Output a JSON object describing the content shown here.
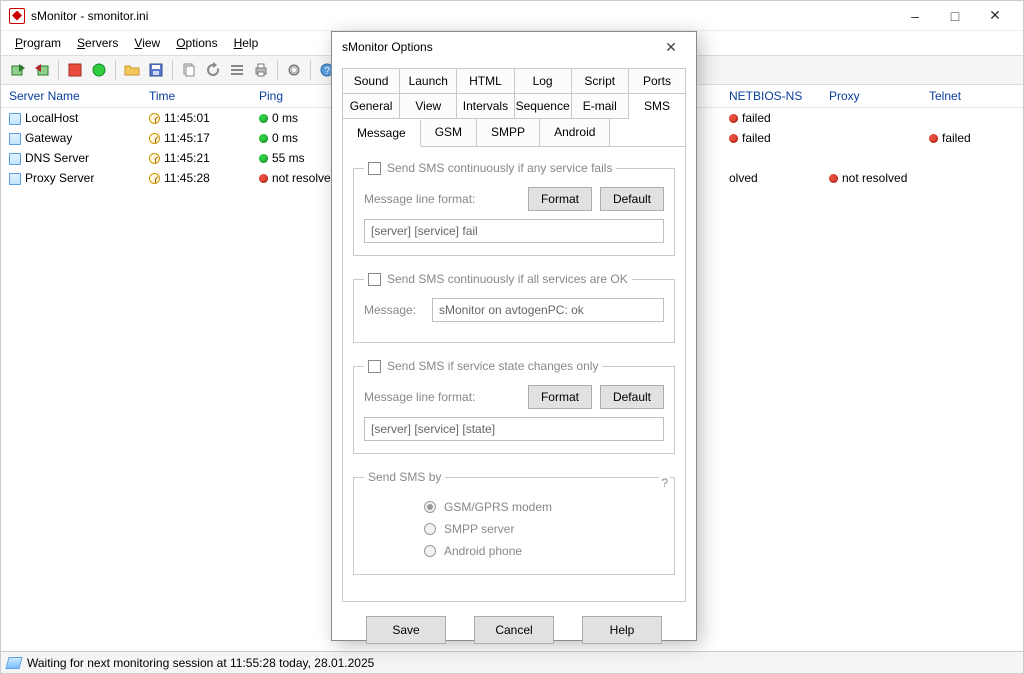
{
  "window": {
    "title": "sMonitor - smonitor.ini"
  },
  "menu": {
    "program": "Program",
    "servers": "Servers",
    "view": "View",
    "options": "Options",
    "help": "Help"
  },
  "columns": {
    "server_name": "Server Name",
    "time": "Time",
    "ping": "Ping",
    "netbios": "NETBIOS-NS",
    "proxy": "Proxy",
    "telnet": "Telnet"
  },
  "rows": [
    {
      "name": "LocalHost",
      "time": "11:45:01",
      "ping": "0 ms",
      "ping_state": "green",
      "netbios": "failed",
      "netbios_state": "red",
      "proxy": "",
      "telnet": ""
    },
    {
      "name": "Gateway",
      "time": "11:45:17",
      "ping": "0 ms",
      "ping_state": "green",
      "netbios": "failed",
      "netbios_state": "red",
      "proxy": "",
      "telnet": "failed",
      "telnet_state": "red"
    },
    {
      "name": "DNS Server",
      "time": "11:45:21",
      "ping": "55 ms",
      "ping_state": "green",
      "netbios": "",
      "proxy": "",
      "telnet": ""
    },
    {
      "name": "Proxy Server",
      "time": "11:45:28",
      "ping": "not resolved",
      "ping_state": "red",
      "netbios": "",
      "netbios_partial": "olved",
      "proxy": "not resolved",
      "proxy_state": "red",
      "telnet": ""
    }
  ],
  "status": "Waiting for next monitoring session at 11:55:28 today, 28.01.2025",
  "dialog": {
    "title": "sMonitor Options",
    "tabs_row1": [
      "Sound",
      "Launch",
      "HTML",
      "Log",
      "Script",
      "Ports"
    ],
    "tabs_row2": [
      "General",
      "View",
      "Intervals",
      "Sequence",
      "E-mail",
      "SMS"
    ],
    "active_tab": "SMS",
    "subtabs": [
      "Message",
      "GSM",
      "SMPP",
      "Android"
    ],
    "active_subtab": "Message",
    "group1": {
      "legend": "Send SMS continuously if any service fails",
      "label": "Message line format:",
      "format_btn": "Format",
      "default_btn": "Default",
      "value": "[server] [service] fail"
    },
    "group2": {
      "legend": "Send SMS continuously if all services are OK",
      "label": "Message:",
      "value": "sMonitor on avtogenPC: ok"
    },
    "group3": {
      "legend": "Send SMS if service state changes only",
      "label": "Message line format:",
      "format_btn": "Format",
      "default_btn": "Default",
      "value": "[server] [service] [state]"
    },
    "group4": {
      "legend": "Send SMS by",
      "opt1": "GSM/GPRS modem",
      "opt2": "SMPP server",
      "opt3": "Android phone"
    },
    "buttons": {
      "save": "Save",
      "cancel": "Cancel",
      "help": "Help"
    }
  }
}
